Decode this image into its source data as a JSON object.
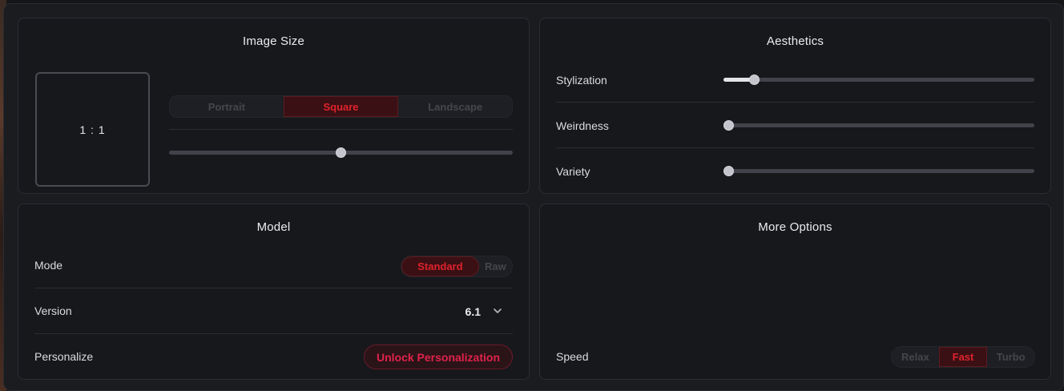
{
  "image_size": {
    "title": "Image Size",
    "ratio": "1 : 1",
    "orientation_options": [
      "Portrait",
      "Square",
      "Landscape"
    ],
    "orientation_selected": "Square",
    "size_slider_value": 0.5
  },
  "aesthetics": {
    "title": "Aesthetics",
    "rows": [
      {
        "label": "Stylization",
        "value": 0.1
      },
      {
        "label": "Weirdness",
        "value": 0.0
      },
      {
        "label": "Variety",
        "value": 0.0
      }
    ]
  },
  "model": {
    "title": "Model",
    "mode_label": "Mode",
    "mode_options": [
      "Standard",
      "Raw"
    ],
    "mode_selected": "Standard",
    "version_label": "Version",
    "version_value": "6.1",
    "personalize_label": "Personalize",
    "personalize_button": "Unlock Personalization"
  },
  "more_options": {
    "title": "More Options",
    "speed_label": "Speed",
    "speed_options": [
      "Relax",
      "Fast",
      "Turbo"
    ],
    "speed_selected": "Fast"
  },
  "colors": {
    "accent": "#e0222c",
    "accent_bg": "#3a1014",
    "panel_bg": "#17181c",
    "track": "#42434a"
  },
  "icons": {
    "version_dropdown": "chevron-down-icon"
  }
}
